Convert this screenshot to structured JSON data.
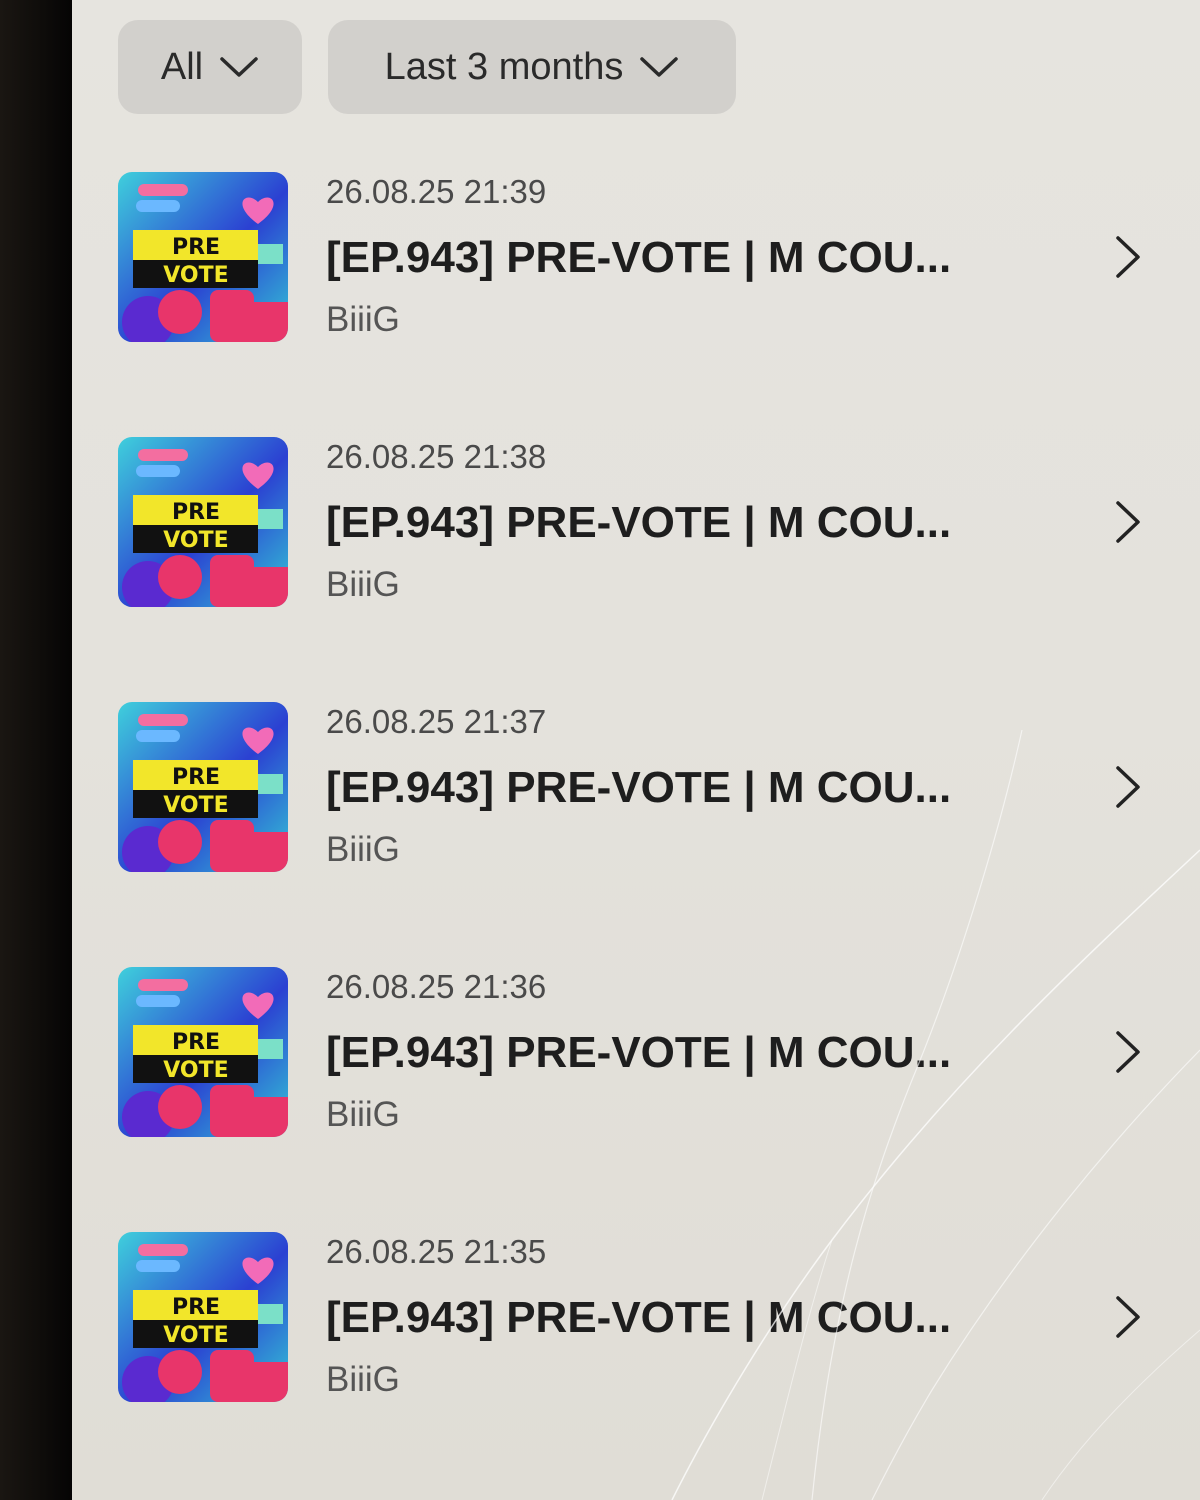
{
  "filters": {
    "type_label": "All",
    "period_label": "Last 3 months"
  },
  "thumbnail": {
    "line1": "PRE",
    "line2": "VOTE"
  },
  "items": [
    {
      "date": "26.08.25 21:39",
      "title": "[EP.943] PRE-VOTE | M COU...",
      "author": "BiiiG"
    },
    {
      "date": "26.08.25 21:38",
      "title": "[EP.943] PRE-VOTE | M COU...",
      "author": "BiiiG"
    },
    {
      "date": "26.08.25 21:37",
      "title": "[EP.943] PRE-VOTE | M COU...",
      "author": "BiiiG"
    },
    {
      "date": "26.08.25 21:36",
      "title": "[EP.943] PRE-VOTE | M COU...",
      "author": "BiiiG"
    },
    {
      "date": "26.08.25 21:35",
      "title": "[EP.943] PRE-VOTE | M COU...",
      "author": "BiiiG"
    }
  ],
  "icons": {
    "dropdown": "chevron-down-icon",
    "row_action": "chevron-right-icon"
  },
  "colors": {
    "screen_bg": "#e4e2dc",
    "chip_bg": "#d2d0cc",
    "text_primary": "#1e1e1e",
    "thumb_yellow": "#f2e62a",
    "thumb_teal": "#34c8d6",
    "thumb_blue": "#2b3fd0",
    "thumb_pink": "#e8356a"
  }
}
